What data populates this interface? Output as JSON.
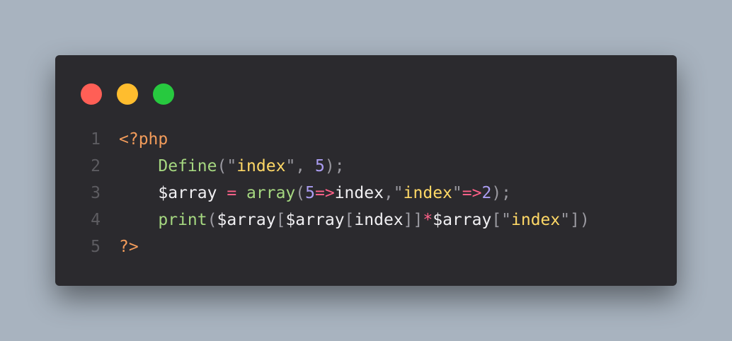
{
  "window": {
    "controls": [
      "close",
      "minimize",
      "maximize"
    ],
    "colors": {
      "close": "#ff5f56",
      "minimize": "#ffbd2e",
      "maximize": "#27c93f"
    }
  },
  "code": {
    "line_numbers": [
      "1",
      "2",
      "3",
      "4",
      "5"
    ],
    "lines": [
      [
        {
          "t": "<?php",
          "c": "tag"
        }
      ],
      [
        {
          "t": "    ",
          "c": "var"
        },
        {
          "t": "Define",
          "c": "fn"
        },
        {
          "t": "(\"",
          "c": "punc"
        },
        {
          "t": "index",
          "c": "str"
        },
        {
          "t": "\", ",
          "c": "punc"
        },
        {
          "t": "5",
          "c": "num"
        },
        {
          "t": ");",
          "c": "punc"
        }
      ],
      [
        {
          "t": "    ",
          "c": "var"
        },
        {
          "t": "$array",
          "c": "var"
        },
        {
          "t": " = ",
          "c": "op"
        },
        {
          "t": "array",
          "c": "fn"
        },
        {
          "t": "(",
          "c": "punc"
        },
        {
          "t": "5",
          "c": "num"
        },
        {
          "t": "=>",
          "c": "op"
        },
        {
          "t": "index",
          "c": "var"
        },
        {
          "t": ",\"",
          "c": "punc"
        },
        {
          "t": "index",
          "c": "str"
        },
        {
          "t": "\"",
          "c": "punc"
        },
        {
          "t": "=>",
          "c": "op"
        },
        {
          "t": "2",
          "c": "num"
        },
        {
          "t": ");",
          "c": "punc"
        }
      ],
      [
        {
          "t": "    ",
          "c": "var"
        },
        {
          "t": "print",
          "c": "fn"
        },
        {
          "t": "(",
          "c": "punc"
        },
        {
          "t": "$array",
          "c": "var"
        },
        {
          "t": "[",
          "c": "punc"
        },
        {
          "t": "$array",
          "c": "var"
        },
        {
          "t": "[",
          "c": "punc"
        },
        {
          "t": "index",
          "c": "var"
        },
        {
          "t": "]]",
          "c": "punc"
        },
        {
          "t": "*",
          "c": "op"
        },
        {
          "t": "$array",
          "c": "var"
        },
        {
          "t": "[\"",
          "c": "punc"
        },
        {
          "t": "index",
          "c": "str"
        },
        {
          "t": "\"])",
          "c": "punc"
        }
      ],
      [
        {
          "t": "?>",
          "c": "tag"
        }
      ]
    ]
  }
}
